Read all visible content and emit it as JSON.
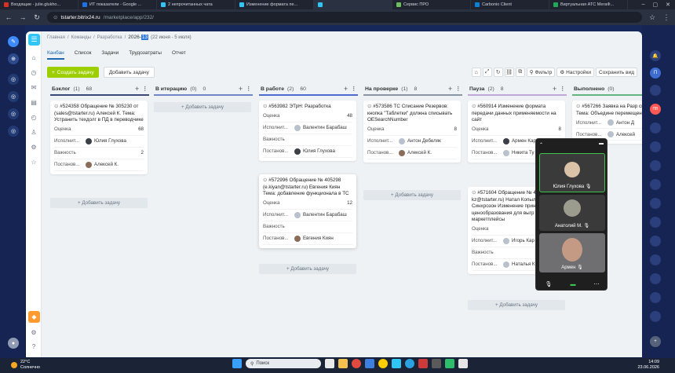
{
  "browser": {
    "tabs": [
      {
        "title": "Входящие - julie.glukho...",
        "color": "#d93025"
      },
      {
        "title": "ИТ показатели - Google ...",
        "color": "#1a73e8"
      },
      {
        "title": "2 непрочитанных чата",
        "color": "#2fc6f6"
      },
      {
        "title": "Изменение формата пе...",
        "color": "#2fc6f6"
      },
      {
        "title": "",
        "color": "#2fc6f6"
      },
      {
        "title": "Сервис ПРО",
        "color": "#6bbf59"
      },
      {
        "title": "Carbonio Client",
        "color": "#0b80d9"
      },
      {
        "title": "Виртуальная АТС МегаФ...",
        "color": "#1fa855"
      }
    ],
    "url_host": "tstarter.bitrix24.ru",
    "url_path": "/marketplace/app/232/"
  },
  "breadcrumbs": {
    "items": [
      "Главная",
      "Команды",
      "Разработка"
    ],
    "title_prefix": "2026-",
    "title_selected": "13",
    "dates": "(22 июня - 5 июля)"
  },
  "views": [
    "Канбан",
    "Список",
    "Задачи",
    "Трудозатраты",
    "Отчет"
  ],
  "toolbar": {
    "create_task": "Создать задачу",
    "add_task": "Добавить задачу",
    "filter": "Фильтр",
    "settings": "Настройки",
    "save_view": "Сохранить вид"
  },
  "field_labels": {
    "estimate": "Оценка",
    "executor": "Исполнит...",
    "importance": "Важность",
    "creator": "Постанов..."
  },
  "add_task_link": "+ Добавить задачу",
  "columns": [
    {
      "name": "Бэклог",
      "count": "(1)",
      "points": "68"
    },
    {
      "name": "В итерацию",
      "count": "(0)",
      "points": "0"
    },
    {
      "name": "В работе",
      "count": "(2)",
      "points": "60"
    },
    {
      "name": "На проверке",
      "count": "(1)",
      "points": "8"
    },
    {
      "name": "Пауза",
      "count": "(2)",
      "points": "8"
    },
    {
      "name": "Выполнено",
      "count": "(0)",
      "points": ""
    }
  ],
  "cards": {
    "c1": {
      "title": "#524358 Обращение № 305230 от (sales@tstarter.ru) Алексей К. Тема: Устранить техдолг в ПД в переводчике",
      "estimate": "68",
      "executor": "Юлия Глухова",
      "importance": "2",
      "creator": "Алексей К."
    },
    "c2": {
      "title": "#563982 ЭТрН: Разработка",
      "estimate": "48",
      "executor": "Валентин Барабаш",
      "creator": "Юлия Глухова"
    },
    "c3": {
      "title": "#572996 Обращение № 405298 (e.kiyan@tstarter.ru) Евгения Киян Тема: добавление функционала в ТС",
      "estimate": "12",
      "executor": "Валентин Барабаш",
      "creator": "Евгения Киян"
    },
    "c4": {
      "title": "#573586 ТС Списание Резервов: кнопка \"Таблетки\" должна списывать ОЕSearchNumber",
      "estimate": "8",
      "executor": "Антон Дебеляк",
      "creator": "Алексей К."
    },
    "c5": {
      "title": "#560914 Изменение формата передачи данных применяемости на сайт",
      "estimate": "8",
      "executor": "Армен Кар",
      "creator": "Никита Ту"
    },
    "c6": {
      "title": "#571604 Обращение № 4 (info3-kz@tstarter.ru) Натал Копылова Тема: Синхрозон Изменение принципа ценообразования для выгр маркетплейсы",
      "executor": "Игорь Кар",
      "creator": "Наталья К"
    },
    "c7": {
      "title": "#567266 Заявка на Разр систем. Тема: Объедине перемещений",
      "executor": "Антон Д",
      "creator": "Алексей"
    }
  },
  "call": {
    "participants": [
      "Юлия Глухова",
      "Анатолий М.",
      "Армен"
    ]
  },
  "right_rail": [
    "П",
    "ПВ"
  ],
  "taskbar": {
    "weather_temp": "22°C",
    "weather_desc": "Солнечно",
    "search_placeholder": "Поиск",
    "time": "14:09",
    "date": "23.06.2026"
  }
}
